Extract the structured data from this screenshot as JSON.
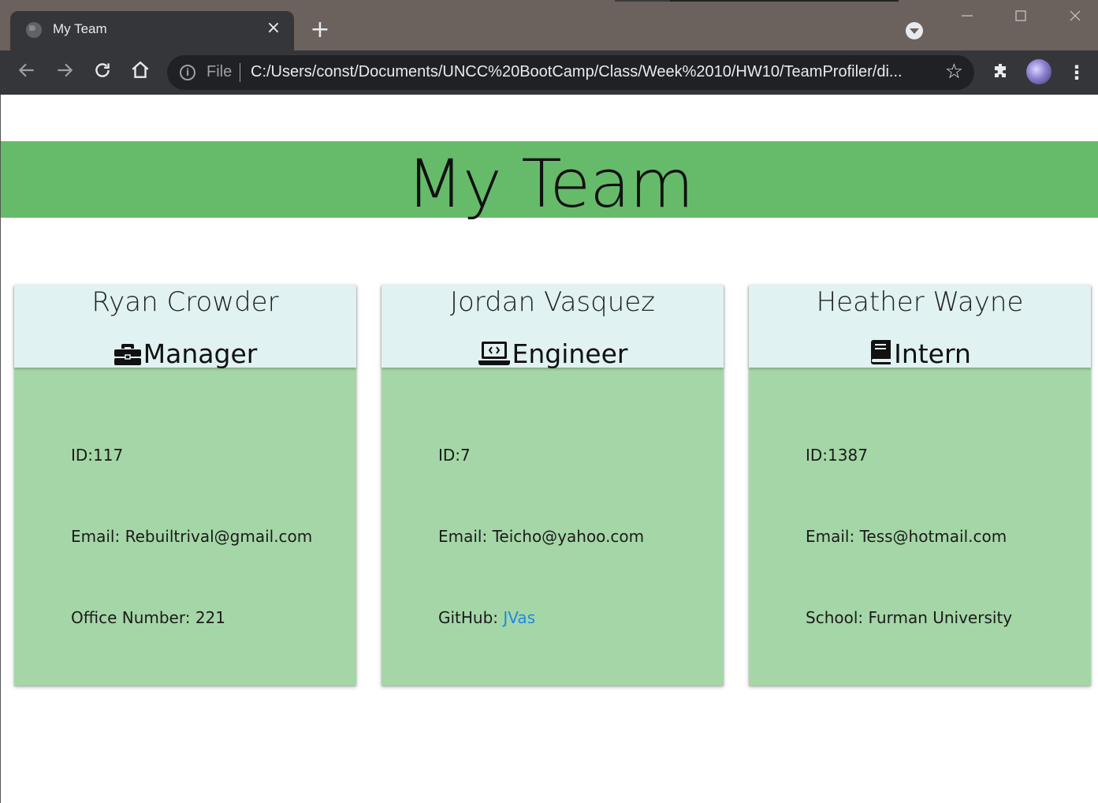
{
  "browser": {
    "tab_title": "My Team",
    "tab_close": "×",
    "new_tab": "+",
    "scheme_label": "File",
    "url": "C:/Users/const/Documents/UNCC%20BootCamp/Class/Week%2010/HW10/TeamProfiler/di...",
    "icons": [
      "globe-icon",
      "back-icon",
      "forward-icon",
      "reload-icon",
      "home-icon",
      "info-icon",
      "star-icon",
      "extensions-icon",
      "menu-icon"
    ]
  },
  "page": {
    "heading": "My Team",
    "colors": {
      "jumbotron": "#66bb6a",
      "card_header": "#e0f2f1",
      "card_body": "#a5d6a7",
      "link": "#1e88e5"
    }
  },
  "team": [
    {
      "name": "Ryan Crowder",
      "role": "Manager",
      "role_icon": "briefcase-icon",
      "id_label": "ID:117",
      "email_prefix": "Email: ",
      "email": "Rebuiltrival@gmail.com",
      "extra_prefix": "Office Number: ",
      "extra": "221"
    },
    {
      "name": "Jordan Vasquez",
      "role": "Engineer",
      "role_icon": "laptop-code-icon",
      "id_label": "ID:7",
      "email_prefix": "Email: ",
      "email": "Teicho@yahoo.com",
      "extra_prefix": "GitHub: ",
      "extra": "JVas"
    },
    {
      "name": "Heather Wayne",
      "role": "Intern",
      "role_icon": "book-icon",
      "id_label": "ID:1387",
      "email_prefix": "Email: ",
      "email": "Tess@hotmail.com",
      "extra_prefix": "School: ",
      "extra": "Furman University"
    }
  ]
}
